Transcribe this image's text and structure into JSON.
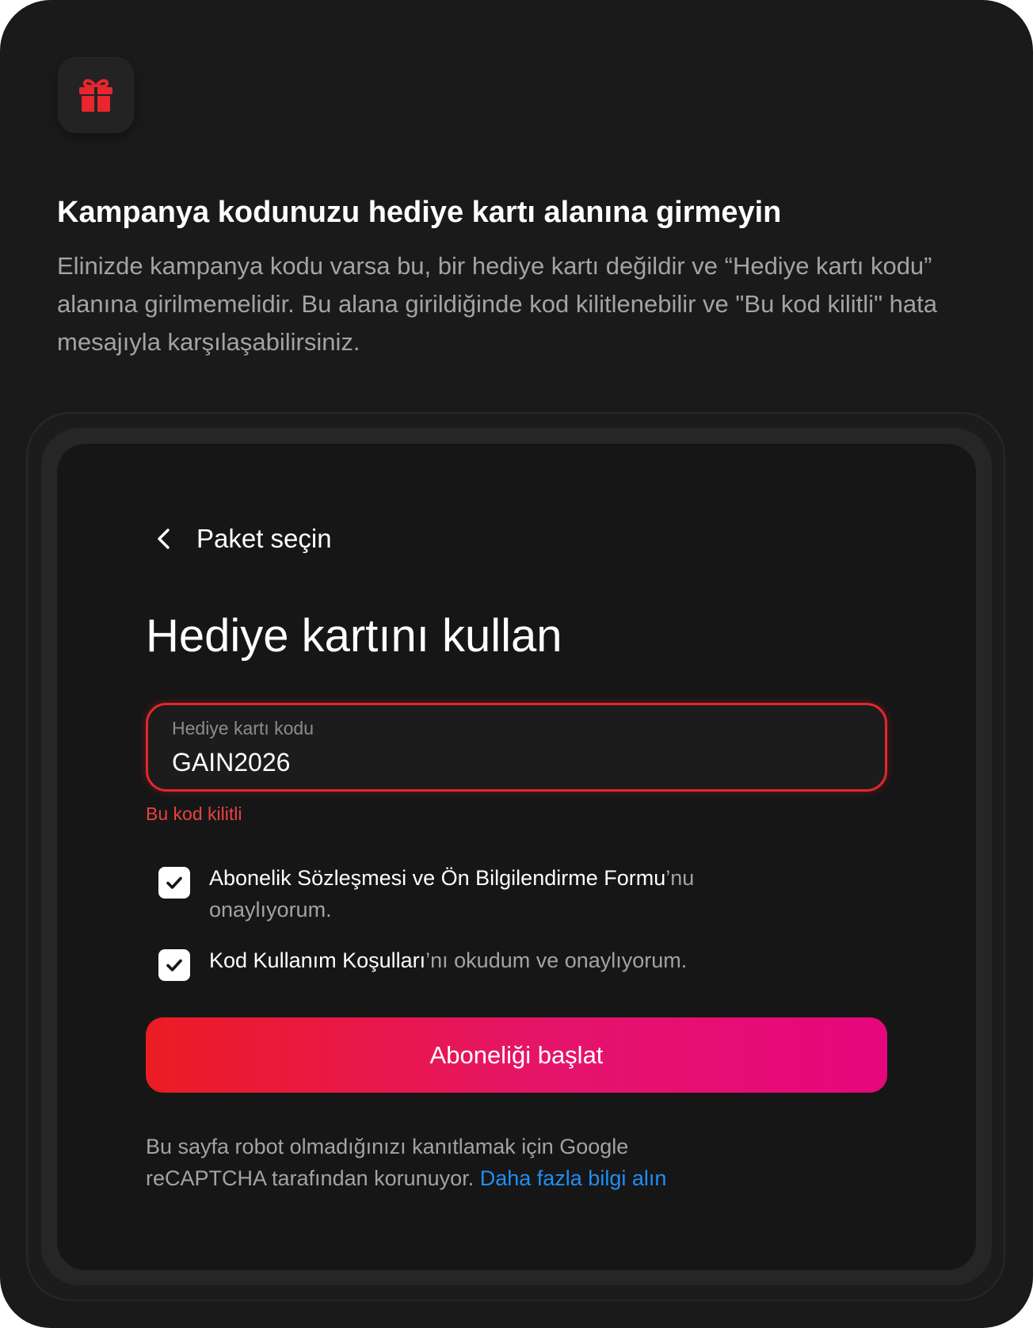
{
  "info": {
    "title": "Kampanya kodunuzu hediye kartı alanına girmeyin",
    "text": "Elinizde kampanya kodu varsa bu, bir hediye kartı değildir ve “Hediye kartı kodu” alanına girilmemelidir. Bu alana girildiğinde kod kilitlenebilir ve \"Bu kod kilitli\" hata mesajıyla karşılaşabilirsiniz."
  },
  "icons": {
    "badge": "gift-icon",
    "back": "chevron-left-icon",
    "check": "checkmark-icon"
  },
  "form": {
    "back_label": "Paket seçin",
    "title": "Hediye kartını kullan",
    "field_label": "Hediye kartı kodu",
    "field_value": "GAIN2026",
    "error": "Bu kod kilitli",
    "consents": [
      {
        "link": "Abonelik Sözleşmesi ve Ön Bilgilendirme Formu",
        "suffix": "’nu onaylıyorum.",
        "checked": true
      },
      {
        "link": "Kod Kullanım Koşulları",
        "suffix": "’nı okudum ve onaylıyorum.",
        "checked": true
      }
    ],
    "cta": "Aboneliği başlat",
    "recaptcha_text": "Bu sayfa robot olmadığınızı kanıtlamak için Google reCAPTCHA tarafından korunuyor. ",
    "recaptcha_link": "Daha fazla bilgi alın"
  },
  "colors": {
    "background": "#1a1a1a",
    "error": "#ec4141",
    "cta_start": "#ec1c24",
    "cta_end": "#e6077d",
    "link": "#1f8ff5"
  }
}
